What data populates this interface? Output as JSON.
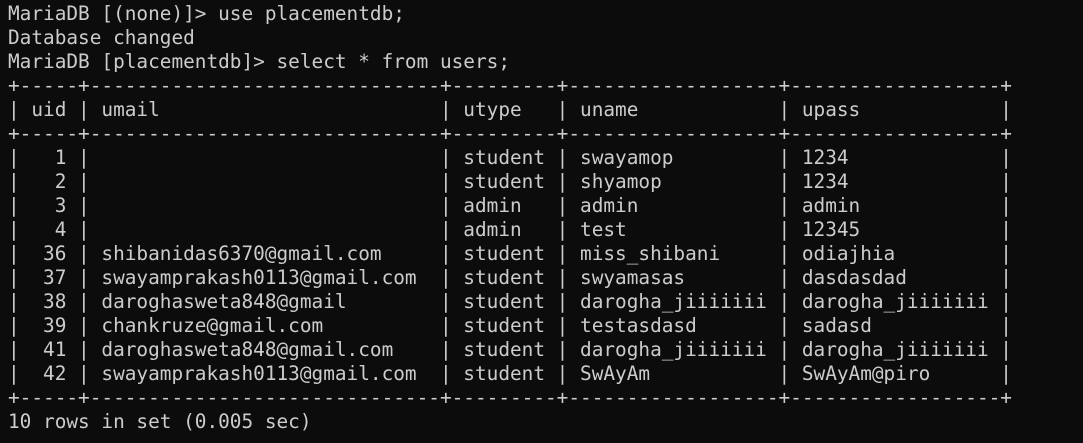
{
  "terminal": {
    "colors": {
      "background": "#0c0c0c",
      "foreground": "#cccccc"
    },
    "lines": [
      "MariaDB [(none)]> use placementdb;",
      "Database changed",
      "MariaDB [placementdb]> select * from users;",
      "+-----+------------------------------+---------+------------------+------------------+",
      "| uid | umail                        | utype   | uname            | upass            |",
      "+-----+------------------------------+---------+------------------+------------------+",
      "|   1 |                              | student | swayamop         | 1234             |",
      "|   2 |                              | student | shyamop          | 1234             |",
      "|   3 |                              | admin   | admin            | admin            |",
      "|   4 |                              | admin   | test             | 12345            |",
      "|  36 | shibanidas6370@gmail.com     | student | miss_shibani     | odiajhia         |",
      "|  37 | swayamprakash0113@gmail.com  | student | swyamasas        | dasdasdad        |",
      "|  38 | daroghasweta848@gmail        | student | darogha_jiiiiiii | darogha_jiiiiiii |",
      "|  39 | chankruze@gmail.com          | student | testasdasd       | sadasd           |",
      "|  41 | daroghasweta848@gmail.com    | student | darogha_jiiiiiii | darogha_jiiiiiii |",
      "|  42 | swayamprakash0113@gmail.com  | student | SwAyAm           | SwAyAm@piro      |",
      "+-----+------------------------------+---------+------------------+------------------+",
      "10 rows in set (0.005 sec)"
    ]
  }
}
